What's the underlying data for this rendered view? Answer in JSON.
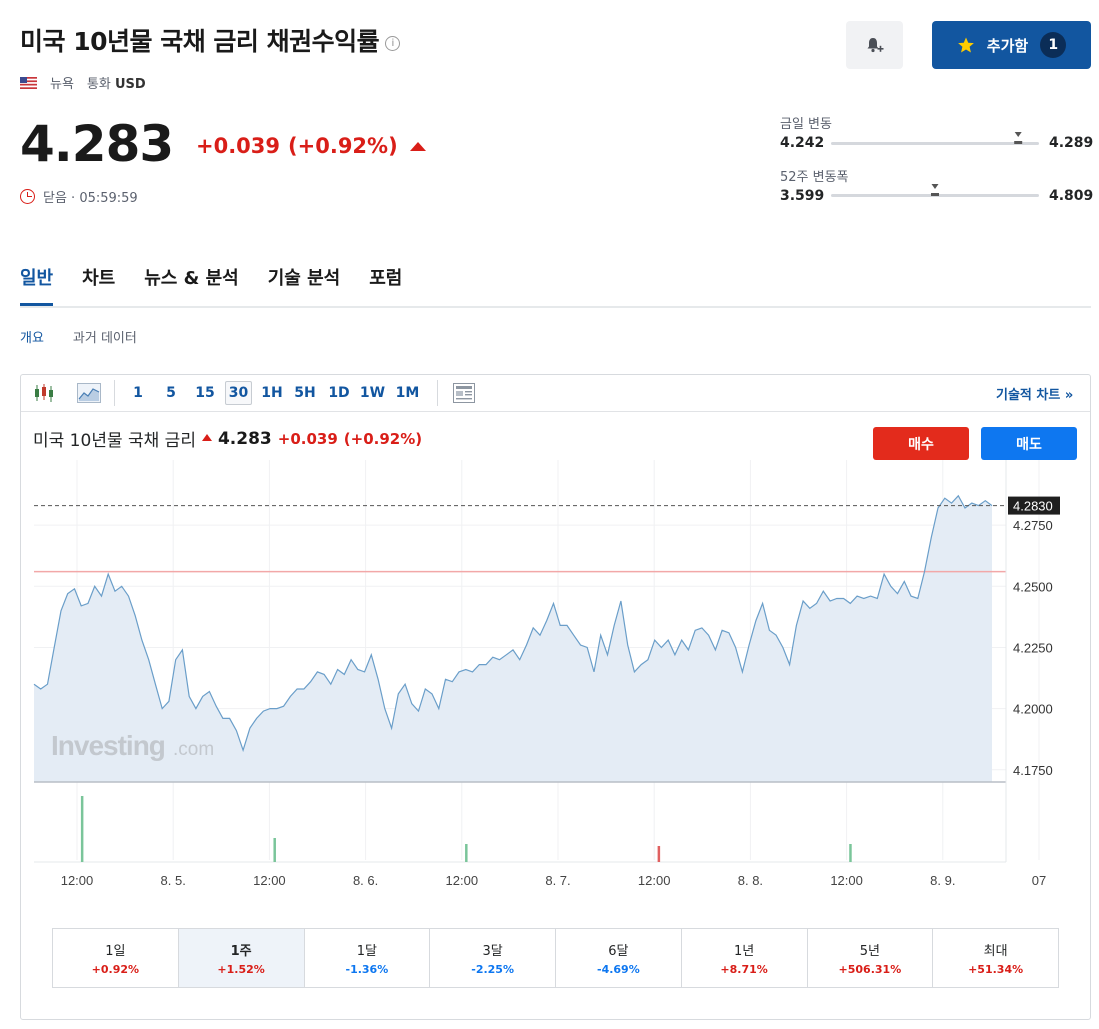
{
  "header": {
    "title": "미국 10년물 국채 금리 채권수익률",
    "info_icon": "info-icon",
    "region": "뉴욕",
    "currency_label": "통화",
    "currency": "USD",
    "add_label": "추가함",
    "add_count": "1"
  },
  "quote": {
    "price": "4.283",
    "change": "+0.039",
    "change_pct": "(+0.92%)",
    "status": "닫음 · 05:59:59"
  },
  "ranges": {
    "day_label": "금일 변동",
    "day_low": "4.242",
    "day_high": "4.289",
    "day_pos": 0.9,
    "week52_label": "52주 변동폭",
    "week52_low": "3.599",
    "week52_high": "4.809",
    "week52_pos": 0.5
  },
  "tabs": [
    "일반",
    "차트",
    "뉴스 & 분석",
    "기술 분석",
    "포럼"
  ],
  "subtabs": [
    "개요",
    "과거 데이터"
  ],
  "toolbar": {
    "intervals": [
      "1",
      "5",
      "15",
      "30",
      "1H",
      "5H",
      "1D",
      "1W",
      "1M"
    ],
    "active_interval": "30",
    "tech_link": "기술적 차트 »"
  },
  "chart_header": {
    "name": "미국 10년물 국채 금리",
    "price": "4.283",
    "change": "+0.039",
    "change_pct": "(+0.92%)",
    "buy": "매수",
    "sell": "매도"
  },
  "chart_data": {
    "type": "area",
    "watermark_main": "Investing",
    "watermark_suffix": ".com",
    "current_label": "4.2830",
    "current_value": 4.283,
    "reference_value": 4.256,
    "ylim": [
      4.17,
      4.3
    ],
    "y_ticks": [
      "4.2750",
      "4.2500",
      "4.2250",
      "4.2000",
      "4.1750"
    ],
    "x_ticks": [
      "12:00",
      "8. 5.",
      "12:00",
      "8. 6.",
      "12:00",
      "8. 7.",
      "12:00",
      "8. 8.",
      "12:00",
      "8. 9.",
      "07"
    ],
    "series": [
      {
        "values": [
          4.21,
          4.208,
          4.21,
          4.225,
          4.24,
          4.247,
          4.249,
          4.242,
          4.243,
          4.25,
          4.246,
          4.255,
          4.248,
          4.25,
          4.246,
          4.238,
          4.228,
          4.22,
          4.21,
          4.2,
          4.203,
          4.22,
          4.224,
          4.205,
          4.2,
          4.205,
          4.207,
          4.201,
          4.196,
          4.196,
          4.191,
          4.183,
          4.192,
          4.196,
          4.199,
          4.2,
          4.2,
          4.201,
          4.205,
          4.208,
          4.208,
          4.211,
          4.215,
          4.214,
          4.21,
          4.216,
          4.214,
          4.22,
          4.216,
          4.215,
          4.222,
          4.212,
          4.2,
          4.192,
          4.206,
          4.21,
          4.202,
          4.199,
          4.208,
          4.206,
          4.2,
          4.212,
          4.211,
          4.215,
          4.216,
          4.215,
          4.218,
          4.218,
          4.221,
          4.22,
          4.222,
          4.224,
          4.22,
          4.226,
          4.233,
          4.23,
          4.236,
          4.243,
          4.234,
          4.234,
          4.23,
          4.226,
          4.225,
          4.215,
          4.23,
          4.222,
          4.234,
          4.244,
          4.226,
          4.215,
          4.218,
          4.22,
          4.228,
          4.225,
          4.228,
          4.222,
          4.228,
          4.224,
          4.232,
          4.233,
          4.23,
          4.224,
          4.232,
          4.231,
          4.225,
          4.215,
          4.226,
          4.236,
          4.243,
          4.232,
          4.23,
          4.225,
          4.218,
          4.234,
          4.244,
          4.241,
          4.243,
          4.248,
          4.244,
          4.245,
          4.245,
          4.243,
          4.246,
          4.245,
          4.246,
          4.245,
          4.255,
          4.25,
          4.247,
          4.252,
          4.246,
          4.245,
          4.256,
          4.27,
          4.282,
          4.286,
          4.284,
          4.287,
          4.282,
          4.284,
          4.283,
          4.285,
          4.283
        ]
      }
    ],
    "volume": [
      {
        "pos": 0.05,
        "height": 66,
        "color": "#7ac59a"
      },
      {
        "pos": 0.251,
        "height": 24,
        "color": "#7ac59a"
      },
      {
        "pos": 0.451,
        "height": 18,
        "color": "#7ac59a"
      },
      {
        "pos": 0.652,
        "height": 16,
        "color": "#e06060"
      },
      {
        "pos": 0.852,
        "height": 18,
        "color": "#7ac59a"
      }
    ]
  },
  "periods": [
    {
      "label": "1일",
      "value": "+0.92%",
      "color": "#d91e18",
      "active": false
    },
    {
      "label": "1주",
      "value": "+1.52%",
      "color": "#d91e18",
      "active": true
    },
    {
      "label": "1달",
      "value": "-1.36%",
      "color": "#0e77f0",
      "active": false
    },
    {
      "label": "3달",
      "value": "-2.25%",
      "color": "#0e77f0",
      "active": false
    },
    {
      "label": "6달",
      "value": "-4.69%",
      "color": "#0e77f0",
      "active": false
    },
    {
      "label": "1년",
      "value": "+8.71%",
      "color": "#d91e18",
      "active": false
    },
    {
      "label": "5년",
      "value": "+506.31%",
      "color": "#d91e18",
      "active": false
    },
    {
      "label": "최대",
      "value": "+51.34%",
      "color": "#d91e18",
      "active": false
    }
  ],
  "colors": {
    "accent": "#1256a0",
    "up": "#d91e18",
    "down": "#0e77f0",
    "line": "#6a9ec9",
    "area": "#e4ecf5"
  }
}
